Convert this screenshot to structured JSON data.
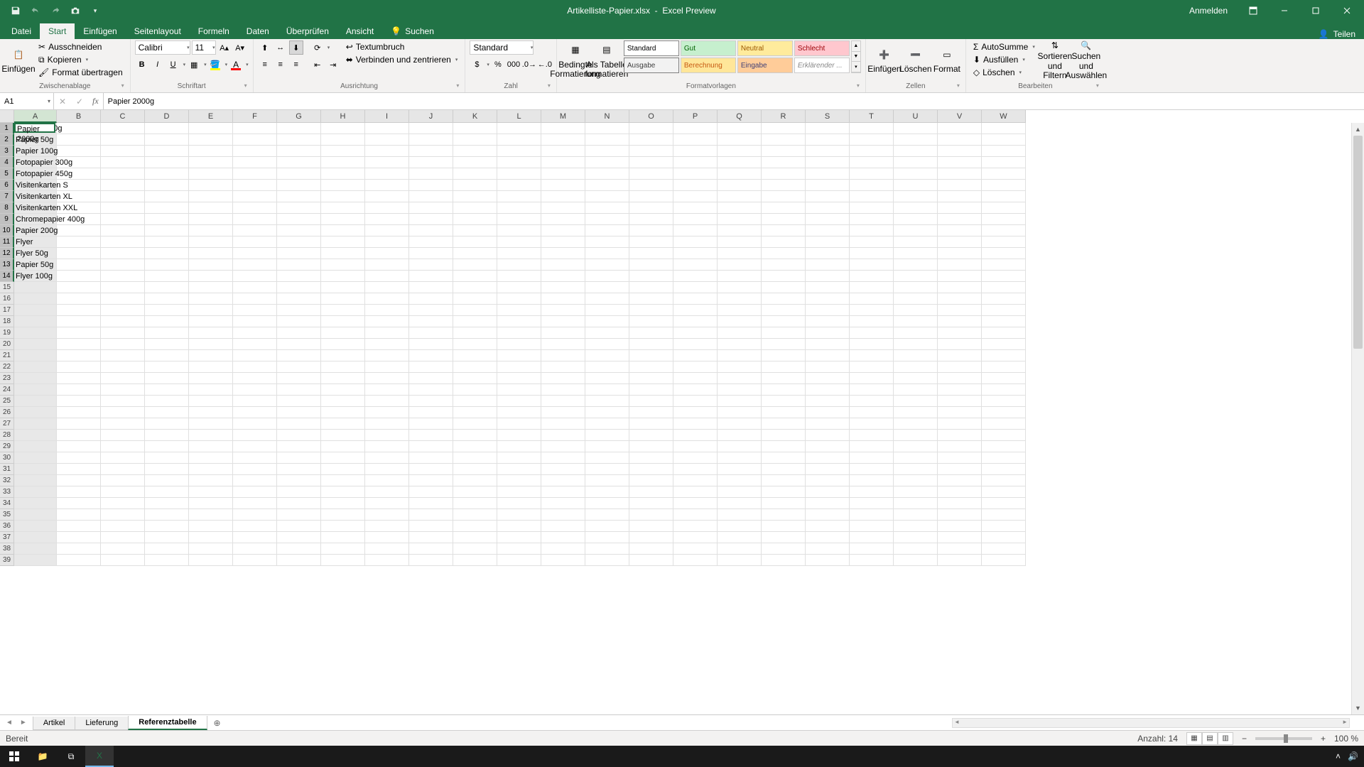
{
  "titlebar": {
    "filename": "Artikelliste-Papier.xlsx",
    "app": "Excel Preview",
    "sign_in": "Anmelden"
  },
  "menu": {
    "file": "Datei",
    "tabs": [
      "Start",
      "Einfügen",
      "Seitenlayout",
      "Formeln",
      "Daten",
      "Überprüfen",
      "Ansicht"
    ],
    "active": "Start",
    "search": "Suchen",
    "share": "Teilen"
  },
  "ribbon": {
    "clipboard": {
      "paste": "Einfügen",
      "cut": "Ausschneiden",
      "copy": "Kopieren",
      "format_painter": "Format übertragen",
      "label": "Zwischenablage"
    },
    "font": {
      "name": "Calibri",
      "size": "11",
      "label": "Schriftart"
    },
    "alignment": {
      "wrap": "Textumbruch",
      "merge": "Verbinden und zentrieren",
      "label": "Ausrichtung"
    },
    "number": {
      "format": "Standard",
      "label": "Zahl"
    },
    "cond_format": "Bedingte Formatierung",
    "table_format": "Als Tabelle formatieren",
    "styles": {
      "items": [
        "Standard",
        "Gut",
        "Neutral",
        "Schlecht",
        "Ausgabe",
        "Berechnung",
        "Eingabe",
        "Erklärender ..."
      ],
      "label": "Formatvorlagen"
    },
    "cells": {
      "insert": "Einfügen",
      "delete": "Löschen",
      "format": "Format",
      "label": "Zellen"
    },
    "editing": {
      "autosum": "AutoSumme",
      "fill": "Ausfüllen",
      "clear": "Löschen",
      "sort": "Sortieren und Filtern",
      "find": "Suchen und Auswählen",
      "label": "Bearbeiten"
    }
  },
  "formula_bar": {
    "namebox": "A1",
    "formula": "Papier 2000g"
  },
  "columns": [
    "A",
    "B",
    "C",
    "D",
    "E",
    "F",
    "G",
    "H",
    "I",
    "J",
    "K",
    "L",
    "M",
    "N",
    "O",
    "P",
    "Q",
    "R",
    "S",
    "T",
    "U",
    "V",
    "W"
  ],
  "rows": [
    "1",
    "2",
    "3",
    "4",
    "5",
    "6",
    "7",
    "8",
    "9",
    "10",
    "11",
    "12",
    "13",
    "14",
    "15",
    "16",
    "17",
    "18",
    "19",
    "20",
    "21",
    "22",
    "23",
    "24",
    "25",
    "26",
    "27",
    "28",
    "29",
    "30",
    "31",
    "32",
    "33",
    "34",
    "35",
    "36",
    "37",
    "38",
    "39"
  ],
  "selected_column_index": 0,
  "selected_row_end": 14,
  "cell_data": {
    "A": [
      "Papier 2000g",
      "Papier 50g",
      "Papier 100g",
      "Fotopapier 300g",
      "Fotopapier 450g",
      "Visitenkarten S",
      "Visitenkarten XL",
      "Visitenkarten XXL",
      "Chromepapier 400g",
      "Papier 200g",
      "Flyer",
      "Flyer 50g",
      "Papier 50g",
      "Flyer 100g"
    ]
  },
  "sheets": {
    "tabs": [
      "Artikel",
      "Lieferung",
      "Referenztabelle"
    ],
    "active": "Referenztabelle"
  },
  "status": {
    "ready": "Bereit",
    "count_label": "Anzahl: 14",
    "zoom": "100 %"
  },
  "col_widths": {
    "A": 60,
    "default": 62
  }
}
